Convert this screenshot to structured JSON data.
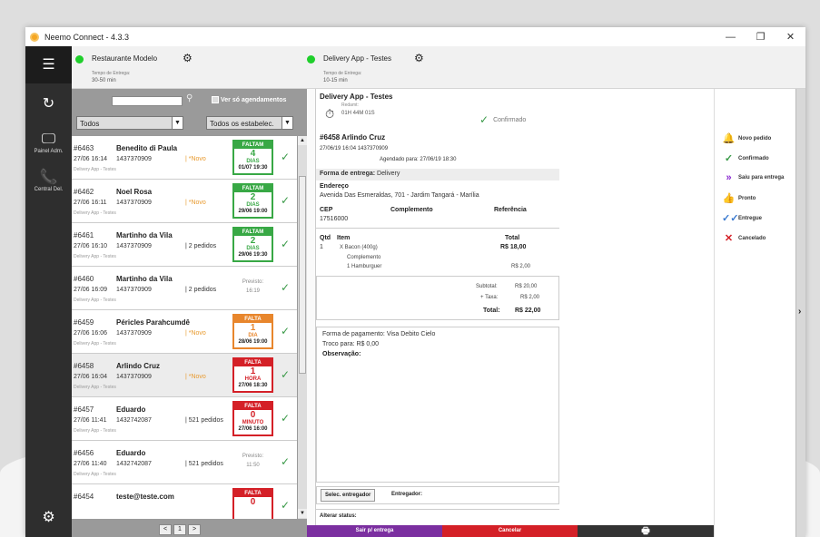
{
  "window": {
    "title": "Neemo Connect  -  4.3.3",
    "controls": [
      "—",
      "❐",
      "✕"
    ]
  },
  "sidebar": {
    "items": [
      {
        "name": "menu",
        "icon": "☰",
        "label": ""
      },
      {
        "name": "refresh",
        "icon": "↻",
        "label": ""
      },
      {
        "name": "painel-adm",
        "icon": "🖵",
        "label": "Painel Adm."
      },
      {
        "name": "central-del",
        "icon": "📞",
        "label": "Central Del."
      },
      {
        "name": "settings",
        "icon": "⚙",
        "label": ""
      }
    ]
  },
  "stores": [
    {
      "name": "Restaurante Modelo",
      "time_label": "Tempo de Entrega:",
      "time_value": "30-50 min"
    },
    {
      "name": "Delivery App - Testes",
      "time_label": "Tempo de Entrega:",
      "time_value": "10-15 min"
    }
  ],
  "filters": {
    "search_placeholder": "",
    "only_scheduled": "Ver só agendamentos",
    "status": "Todos",
    "establishment": "Todos os estabelec."
  },
  "orders": [
    {
      "num": "#6463",
      "name": "Benedito di Paula",
      "time": "27/06 16:14",
      "phone": "1437370909",
      "tag": "| *Novo",
      "novo": true,
      "src": "Delivery App - Testes",
      "badge": {
        "type": "green",
        "head": "FALTAM",
        "n": "4",
        "unit": "DIAS",
        "date": "01/07 19:30"
      }
    },
    {
      "num": "#6462",
      "name": "Noel Rosa",
      "time": "27/06 16:11",
      "phone": "1437370909",
      "tag": "| *Novo",
      "novo": true,
      "src": "Delivery App - Testes",
      "badge": {
        "type": "green",
        "head": "FALTAM",
        "n": "2",
        "unit": "DIAS",
        "date": "29/06 19:00"
      }
    },
    {
      "num": "#6461",
      "name": "Martinho da Vila",
      "time": "27/06 16:10",
      "phone": "1437370909",
      "tag": "| 2 pedidos",
      "novo": false,
      "src": "Delivery App - Testes",
      "badge": {
        "type": "green",
        "head": "FALTAM",
        "n": "2",
        "unit": "DIAS",
        "date": "29/06 19:30"
      }
    },
    {
      "num": "#6460",
      "name": "Martinho da Vila",
      "time": "27/06 16:09",
      "phone": "1437370909",
      "tag": "| 2 pedidos",
      "novo": false,
      "src": "Delivery App - Testes",
      "prev": {
        "label": "Previsto:",
        "time": "16:19"
      }
    },
    {
      "num": "#6459",
      "name": "Péricles Parahcumdê",
      "time": "27/06 16:06",
      "phone": "1437370909",
      "tag": "| *Novo",
      "novo": true,
      "src": "Delivery App - Testes",
      "badge": {
        "type": "orange",
        "head": "FALTA",
        "n": "1",
        "unit": "DIA",
        "date": "28/06 19:00"
      }
    },
    {
      "num": "#6458",
      "name": "Arlindo Cruz",
      "time": "27/06 16:04",
      "phone": "1437370909",
      "tag": "| *Novo",
      "novo": true,
      "src": "Delivery App - Testes",
      "selected": true,
      "badge": {
        "type": "red",
        "head": "FALTA",
        "n": "1",
        "unit": "HORA",
        "date": "27/06 18:30"
      }
    },
    {
      "num": "#6457",
      "name": "Eduardo",
      "time": "27/06 11:41",
      "phone": "1432742087",
      "tag": "| 521 pedidos",
      "novo": false,
      "src": "Delivery App - Testes",
      "badge": {
        "type": "red",
        "head": "FALTA",
        "n": "0",
        "unit": "MINUTO",
        "date": "27/06 16:00"
      }
    },
    {
      "num": "#6456",
      "name": "Eduardo",
      "time": "27/06 11:40",
      "phone": "1432742087",
      "tag": "| 521 pedidos",
      "novo": false,
      "src": "Delivery App - Testes",
      "prev": {
        "label": "Previsto:",
        "time": "11:50"
      }
    },
    {
      "num": "#6454",
      "name": "teste@teste.com",
      "time": "",
      "phone": "",
      "tag": "",
      "novo": false,
      "src": "",
      "badge": {
        "type": "red",
        "head": "FALTA",
        "n": "0",
        "unit": "",
        "date": ""
      }
    }
  ],
  "pager": {
    "prev": "<",
    "page": "1",
    "next": ">"
  },
  "detail": {
    "store": "Delivery App - Testes",
    "redamt_label": "Redamt:",
    "elapsed": "01H 44M 01S",
    "status": "Confirmado",
    "order_title": "#6458  Arlindo Cruz",
    "order_meta": "27/06/19 16:04  1437370909",
    "scheduled": "Agendado para:  27/06/19 18:30",
    "delivery_label": "Forma de entrega:",
    "delivery_value": "Delivery",
    "address_label": "Endereço",
    "address": "Avenida Das Esmeraldas, 701 - Jardim Tangará - Marília",
    "cep_label": "CEP",
    "complement_label": "Complemento",
    "reference_label": "Referência",
    "cep": "17516000",
    "items_header": {
      "qty": "Qtd",
      "item": "Item",
      "total": "Total"
    },
    "item": {
      "qty": "1",
      "name": "X Bacon (400g)",
      "total": "R$ 18,00",
      "complement_label": "Complemento",
      "complement": "1 Hamburguer",
      "complement_price": "R$ 2,00"
    },
    "subtotal_label": "Subtotal:",
    "subtotal": "R$ 20,00",
    "fee_label": "+ Taxa:",
    "fee": "R$ 2,00",
    "total_label": "Total:",
    "total": "R$ 22,00",
    "payment": "Forma de pagamento:  Visa Debito Cielo",
    "change": "Troco para:  R$ 0,00",
    "notes_label": "Observação:",
    "select_courier": "Selec. entregador",
    "courier_label": "Entregador:",
    "alter_status": "Alterar status:",
    "btn_out": "Sair p/ entrega",
    "btn_cancel": "Cancelar",
    "btn_print": "🖶"
  },
  "status_legend": [
    {
      "icon": "🔔",
      "color": "#f0a020",
      "label": "Novo pedido"
    },
    {
      "icon": "✓",
      "color": "#3a9a48",
      "label": "Confirmado"
    },
    {
      "icon": "»",
      "color": "#8a2ad0",
      "label": "Saiu para entrega"
    },
    {
      "icon": "👍",
      "color": "#8a2ad0",
      "label": "Pronto"
    },
    {
      "icon": "✓✓",
      "color": "#3a7ad0",
      "label": "Entregue"
    },
    {
      "icon": "✕",
      "color": "#d42027",
      "label": "Cancelado"
    }
  ],
  "colors": {
    "out_btn": "#7b2fa0",
    "cancel_btn": "#d42027",
    "print_btn": "#333333"
  }
}
